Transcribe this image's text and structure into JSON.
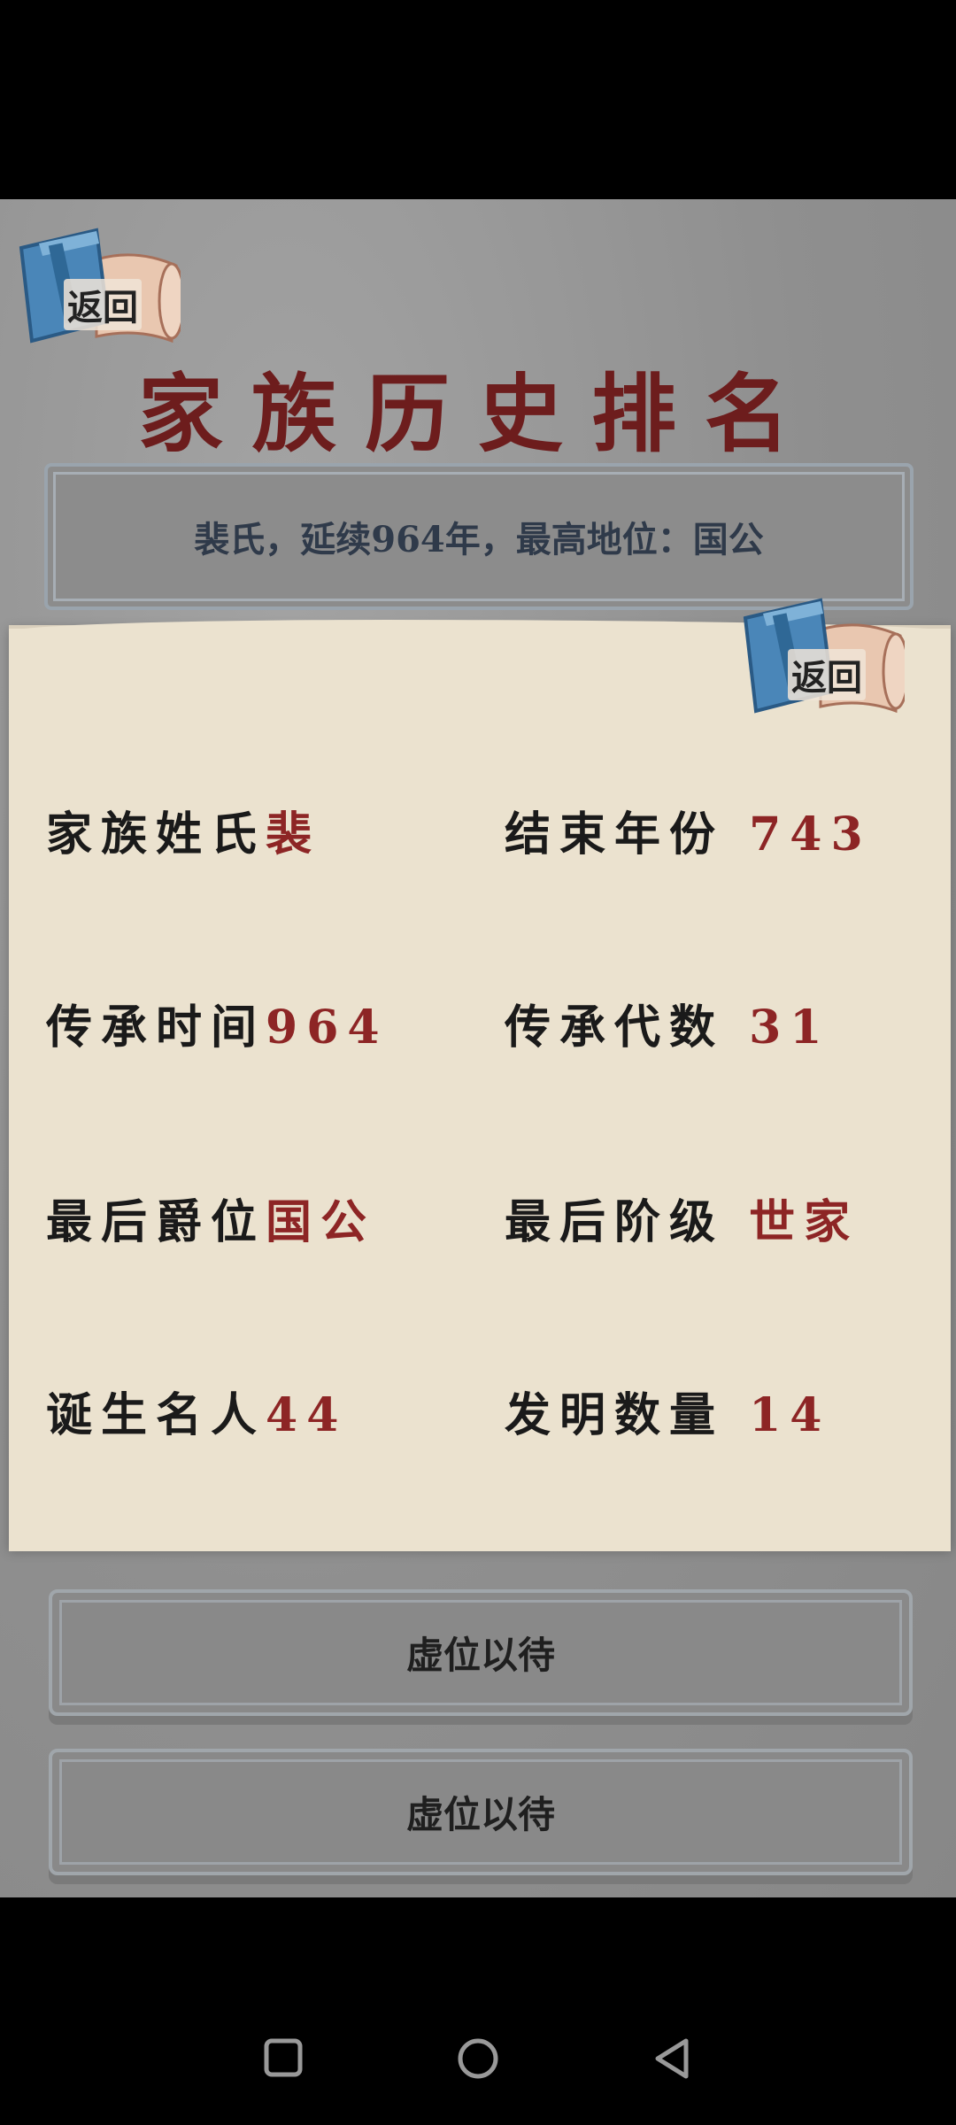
{
  "back_label": "返回",
  "title": "家族历史排名",
  "summary": "裴氏，延续964年，最高地位：国公",
  "list_rows": [
    "虚位以待",
    "虚位以待"
  ],
  "stats": {
    "surname": {
      "label": "家族姓氏",
      "value": "裴"
    },
    "end_year": {
      "label": "结束年份",
      "value": "743"
    },
    "duration": {
      "label": "传承时间",
      "value": "964"
    },
    "generations": {
      "label": "传承代数",
      "value": "31"
    },
    "last_title": {
      "label": "最后爵位",
      "value": "国公"
    },
    "last_class": {
      "label": "最后阶级",
      "value": "世家"
    },
    "celebrities": {
      "label": "诞生名人",
      "value": "44"
    },
    "inventions": {
      "label": "发明数量",
      "value": "14"
    }
  },
  "colors": {
    "title": "#6d1d1d",
    "value": "#8d2525",
    "paper": "#ebe2cf"
  },
  "icons": [
    "book-scroll-icon",
    "square-icon",
    "circle-icon",
    "triangle-back-icon"
  ]
}
